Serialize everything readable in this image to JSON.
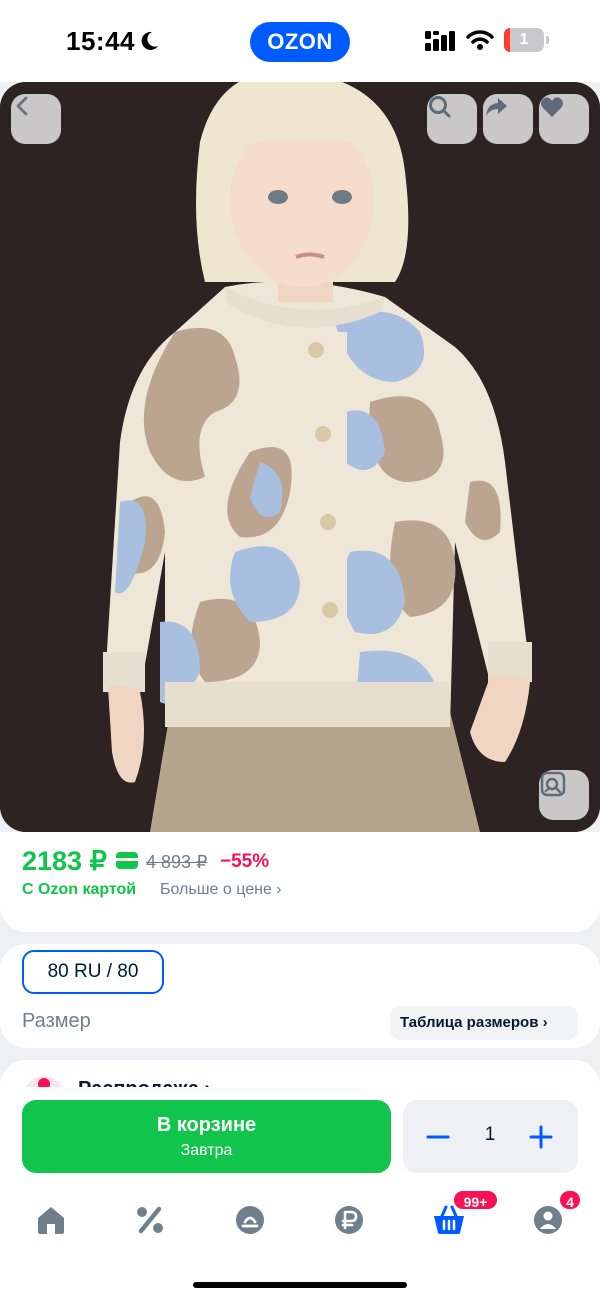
{
  "status_bar": {
    "time": "15:44",
    "logo": "OZON",
    "battery": "1",
    "icons": [
      "moon-icon",
      "signal-icon",
      "wifi-icon",
      "battery-icon"
    ]
  },
  "product_image": {
    "alt": "Child wearing cream cardigan with beige and light-blue abstract pattern",
    "actions": [
      "back-icon",
      "search-icon",
      "share-icon",
      "heart-icon",
      "visual-search-icon"
    ]
  },
  "price": {
    "main": "2183 ₽",
    "old": "4 893 ₽",
    "discount": "−55%",
    "ozon_card_label": "С Ozon картой",
    "more_label": "Больше о цене ›"
  },
  "size": {
    "selected": "80 RU / 80",
    "label": "Размер",
    "table_link": "Таблица размеров ›"
  },
  "sale": {
    "title": "Распродажа ›"
  },
  "actions": {
    "cart_label": "В корзине",
    "cart_sub": "Завтра",
    "quantity": "1"
  },
  "tab_bar": {
    "cart_badge": "99+",
    "profile_badge": "4",
    "icons": [
      "home-icon",
      "percent-icon",
      "catalog-icon",
      "ruble-icon",
      "cart-icon",
      "profile-icon"
    ]
  },
  "colors": {
    "brand_blue": "#005bff",
    "green": "#10c44c",
    "pink": "#f91155",
    "muted": "#707f8d"
  }
}
